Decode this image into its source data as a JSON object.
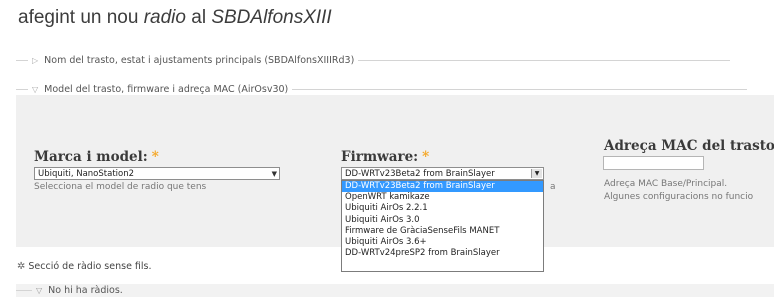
{
  "title": {
    "prefix": "afegint un nou ",
    "radio": "radio",
    "middle": " al ",
    "node": "SBDAlfonsXIII"
  },
  "fieldset1": {
    "legend": "Nom del trasto, estat i ajustaments principals (SBDAlfonsXIIIRd3)",
    "arrow_icon": "right-arrow-icon"
  },
  "fieldset2": {
    "legend": "Model del trasto, firmware i adreça MAC (AirOsv30)",
    "arrow_icon": "down-arrow-icon"
  },
  "fields": {
    "model": {
      "label": "Marca i model:",
      "required_mark": "*",
      "value": "Ubiquiti, NanoStation2",
      "help": "Selecciona el model de radio que tens"
    },
    "firmware": {
      "label": "Firmware:",
      "required_mark": "*",
      "value": "DD-WRTv23Beta2 from BrainSlayer",
      "help_fragment": "a",
      "options": [
        "DD-WRTv23Beta2 from BrainSlayer",
        "OpenWRT kamikaze",
        "Ubiquiti AirOs 2.2.1",
        "Ubiquiti AirOs 3.0",
        "Firmware de GràciaSenseFils MANET",
        "Ubiquiti AirOs 3.6+",
        "DD-WRTv24preSP2 from BrainSlayer"
      ]
    },
    "mac": {
      "label": "Adreça MAC del trasto:",
      "required_mark": "*",
      "help1": "Adreça MAC Base/Principal.",
      "help2": "Algunes configuracions no funcio"
    }
  },
  "wireless_section": {
    "label": "Secció de ràdio sense fils.",
    "icon": "radio-icon"
  },
  "no_radios": {
    "label": "No hi ha ràdios."
  }
}
